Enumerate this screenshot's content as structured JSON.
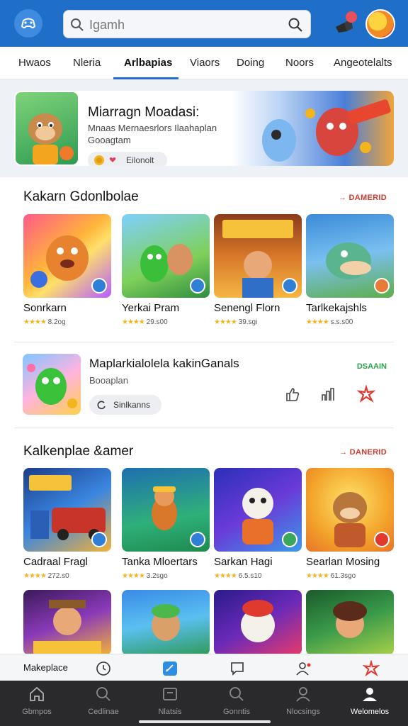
{
  "header": {
    "search_placeholder": "Igamh",
    "colors": {
      "bar": "#1f6fc8",
      "accent": "#d03a2e"
    }
  },
  "tabs": [
    {
      "label": "Hwaos",
      "active": false
    },
    {
      "label": "Nleria",
      "active": false
    },
    {
      "label": "Arlbapias",
      "active": true
    },
    {
      "label": "Viaors",
      "active": false
    },
    {
      "label": "Doing",
      "active": false
    },
    {
      "label": "Noors",
      "active": false
    },
    {
      "label": "Angeotelalts",
      "active": false
    }
  ],
  "banner": {
    "title": "Miarragn Moadasi:",
    "subtitle": "Mnaas Mernaesrlors Ilaahaplan Gooagtam",
    "chip_label": "Eilonolt"
  },
  "sections": [
    {
      "title": "Kakarn Gdonlbolae",
      "link": "→ DAMERID",
      "cards": [
        {
          "title": "Sonrkarn",
          "rating": "8.2og",
          "icon": "game-thumbnail"
        },
        {
          "title": "Yerkai Pram",
          "rating": "29.s00",
          "icon": "game-thumbnail"
        },
        {
          "title": "Senengl Florn",
          "rating": "39.sgi",
          "icon": "game-thumbnail"
        },
        {
          "title": "Tarlkekajshls",
          "rating": "s.s.s00",
          "icon": "game-thumbnail"
        }
      ]
    },
    {
      "title": "Kalkenplae &amer",
      "link": "→ DANERID",
      "cards": [
        {
          "title": "Cadraal Fragl",
          "rating": "272.s0",
          "icon": "game-thumbnail"
        },
        {
          "title": "Tanka Mloertars",
          "rating": "3.2sgo",
          "icon": "game-thumbnail"
        },
        {
          "title": "Sarkan Hagi",
          "rating": "6.5.s10",
          "icon": "game-thumbnail"
        },
        {
          "title": "Searlan Mosing",
          "rating": "61.3sgo",
          "icon": "game-thumbnail"
        }
      ]
    }
  ],
  "featured": {
    "title": "Maplarkialolela kakinGanals",
    "subtitle": "Booaplan",
    "chip_label": "Sinlkanns",
    "link": "DSAAIN"
  },
  "toolbar": {
    "label": "Makeplace"
  },
  "nav": [
    {
      "label": "Gbmpos",
      "icon": "home-icon",
      "active": false
    },
    {
      "label": "Cedlinae",
      "icon": "search-icon",
      "active": false
    },
    {
      "label": "Nlatsis",
      "icon": "library-icon",
      "active": false
    },
    {
      "label": "Gonntis",
      "icon": "search-icon",
      "active": false
    },
    {
      "label": "Nlocsings",
      "icon": "user-icon",
      "active": false
    },
    {
      "label": "Welomelos",
      "icon": "profile-icon",
      "active": true
    }
  ]
}
